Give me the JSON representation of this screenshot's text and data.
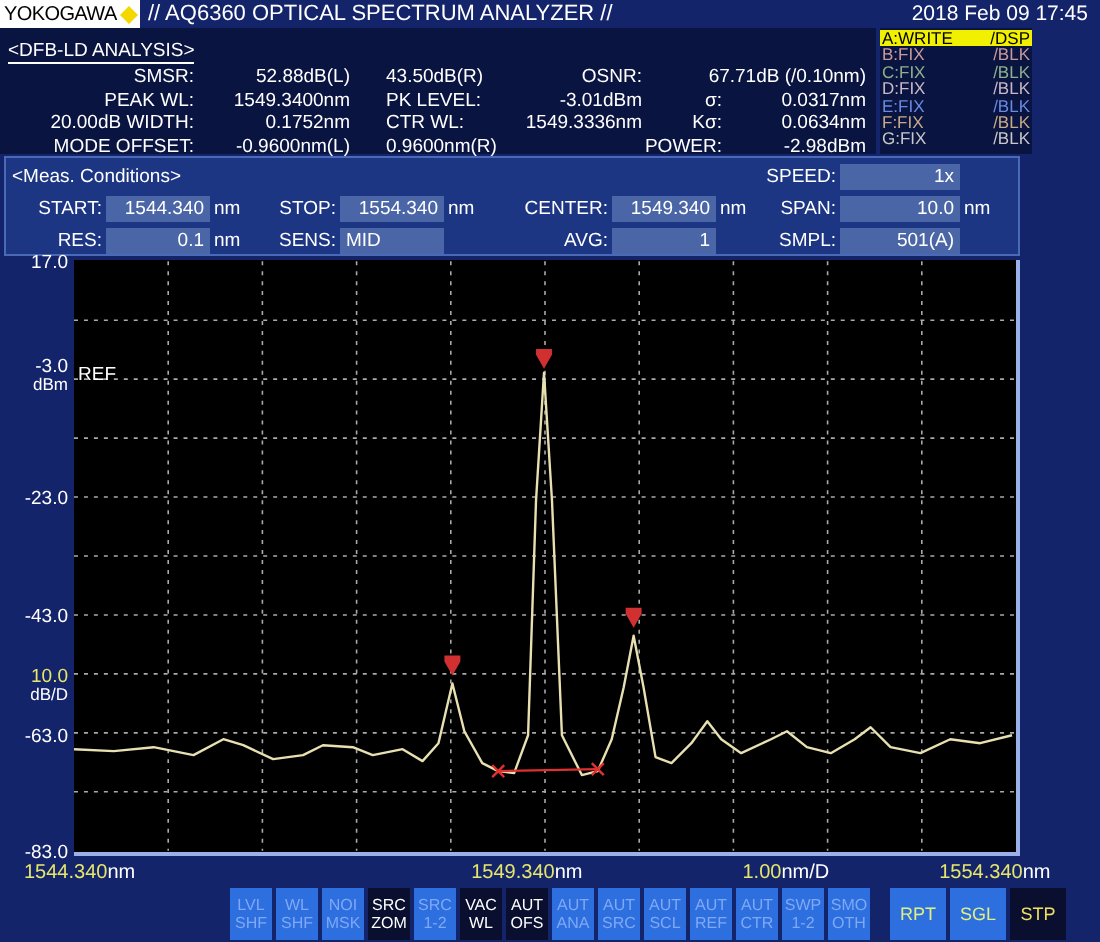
{
  "header": {
    "logo": "YOKOGAWA",
    "title": "// AQ6360 OPTICAL SPECTRUM ANALYZER //",
    "datetime": "2018 Feb 09 17:45"
  },
  "analysis": {
    "title": "<DFB-LD ANALYSIS>",
    "rows": [
      [
        {
          "kind": "label",
          "text": "SMSR:"
        },
        {
          "kind": "value",
          "text": "52.88dB(L)"
        },
        {
          "kind": "item",
          "text": "43.50dB(R)"
        },
        {
          "kind": "value",
          "text": "OSNR:"
        },
        {
          "kind": "wide-value",
          "text": "67.71dB (/0.10nm)"
        }
      ],
      [
        {
          "kind": "label",
          "text": "PEAK WL:"
        },
        {
          "kind": "value",
          "text": "1549.3400nm"
        },
        {
          "kind": "item",
          "text": "PK LEVEL:"
        },
        {
          "kind": "value",
          "text": "-3.01dBm"
        },
        {
          "kind": "label",
          "text": "σ:"
        },
        {
          "kind": "value",
          "text": "0.0317nm"
        }
      ],
      [
        {
          "kind": "label",
          "text": "20.00dB WIDTH:"
        },
        {
          "kind": "value",
          "text": "0.1752nm"
        },
        {
          "kind": "item",
          "text": "CTR WL:"
        },
        {
          "kind": "value",
          "text": "1549.3336nm"
        },
        {
          "kind": "label",
          "text": "Kσ:"
        },
        {
          "kind": "value",
          "text": "0.0634nm"
        }
      ],
      [
        {
          "kind": "label",
          "text": "MODE OFFSET:"
        },
        {
          "kind": "value",
          "text": "-0.9600nm(L)"
        },
        {
          "kind": "item",
          "text": "0.9600nm(R)"
        },
        {
          "kind": "empty",
          "text": ""
        },
        {
          "kind": "label",
          "text": "POWER:"
        },
        {
          "kind": "value",
          "text": "-2.98dBm"
        }
      ]
    ]
  },
  "traces": [
    {
      "name": "A:WRITE",
      "mode": "/DSP",
      "selected": true,
      "color": "#f0f000"
    },
    {
      "name": "B:FIX",
      "mode": "/BLK",
      "selected": false,
      "color": "#c89a9a"
    },
    {
      "name": "C:FIX",
      "mode": "/BLK",
      "selected": false,
      "color": "#8fb08f"
    },
    {
      "name": "D:FIX",
      "mode": "/BLK",
      "selected": false,
      "color": "#c8b8c8"
    },
    {
      "name": "E:FIX",
      "mode": "/BLK",
      "selected": false,
      "color": "#6a8ae0"
    },
    {
      "name": "F:FIX",
      "mode": "/BLK",
      "selected": false,
      "color": "#c8aa88"
    },
    {
      "name": "G:FIX",
      "mode": "/BLK",
      "selected": false,
      "color": "#c8c8c8"
    }
  ],
  "conditions": {
    "title": "<Meas. Conditions>",
    "fields": [
      {
        "label": "SPEED:",
        "value": "1x",
        "kind": "number"
      },
      {
        "label": "START:",
        "value": "1544.340",
        "unit": "nm",
        "kind": "number"
      },
      {
        "label": "STOP:",
        "value": "1554.340",
        "unit": "nm",
        "kind": "number"
      },
      {
        "label": "CENTER:",
        "value": "1549.340",
        "unit": "nm",
        "kind": "number"
      },
      {
        "label": "SPAN:",
        "value": "10.0",
        "unit": "nm",
        "kind": "number"
      },
      {
        "label": "RES:",
        "value": "0.1",
        "unit": "nm",
        "kind": "number"
      },
      {
        "label": "SENS:",
        "value": "MID",
        "kind": "choice"
      },
      {
        "label": "AVG:",
        "value": "1",
        "kind": "number"
      },
      {
        "label": "SMPL:",
        "value": "501(A)",
        "kind": "number"
      }
    ]
  },
  "chart": {
    "y_labels": [
      {
        "text": "17.0",
        "kind": "tick"
      },
      {
        "text": "-3.0",
        "kind": "ref",
        "note": "REF",
        "unit": "dBm"
      },
      {
        "text": "-23.0",
        "kind": "tick"
      },
      {
        "text": "-43.0",
        "kind": "tick"
      },
      {
        "text": "10.0",
        "kind": "scale",
        "unit": "dB/D"
      },
      {
        "text": "-63.0",
        "kind": "tick"
      },
      {
        "text": "-83.0",
        "kind": "tick"
      }
    ],
    "x_labels": [
      {
        "value": "1544.340",
        "unit": "nm"
      },
      {
        "value": "1549.340",
        "unit": "nm"
      },
      {
        "value": "1.00",
        "unit": "nm/D"
      },
      {
        "value": "1554.340",
        "unit": "nm"
      }
    ]
  },
  "softkeys": [
    {
      "lines": [
        "LVL",
        "SHF"
      ],
      "active": false
    },
    {
      "lines": [
        "WL",
        "SHF"
      ],
      "active": false
    },
    {
      "lines": [
        "NOI",
        "MSK"
      ],
      "active": false
    },
    {
      "lines": [
        "SRC",
        "ZOM"
      ],
      "active": true
    },
    {
      "lines": [
        "SRC",
        "1-2"
      ],
      "active": false
    },
    {
      "lines": [
        "VAC",
        "WL"
      ],
      "active": true
    },
    {
      "lines": [
        "AUT",
        "OFS"
      ],
      "active": true
    },
    {
      "lines": [
        "AUT",
        "ANA"
      ],
      "active": false
    },
    {
      "lines": [
        "AUT",
        "SRC"
      ],
      "active": false
    },
    {
      "lines": [
        "AUT",
        "SCL"
      ],
      "active": false
    },
    {
      "lines": [
        "AUT",
        "REF"
      ],
      "active": false
    },
    {
      "lines": [
        "AUT",
        "CTR"
      ],
      "active": false
    },
    {
      "lines": [
        "SWP",
        "1-2"
      ],
      "active": false
    },
    {
      "lines": [
        "SMO",
        "OTH"
      ],
      "active": false
    }
  ],
  "sweep_keys": [
    {
      "label": "RPT",
      "active": false
    },
    {
      "label": "SGL",
      "active": false
    },
    {
      "label": "STP",
      "active": true
    }
  ]
}
